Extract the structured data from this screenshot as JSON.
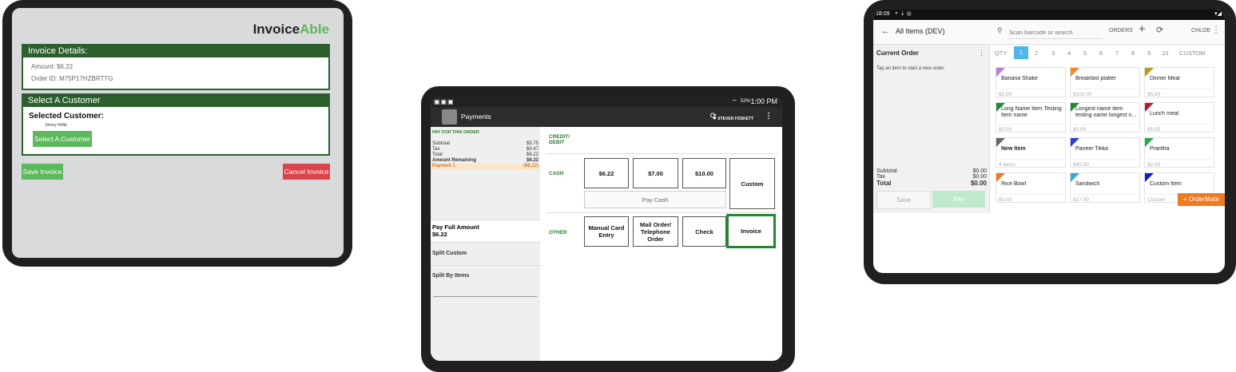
{
  "invoiceable": {
    "logo_main": "Invoice",
    "logo_accent": "Able",
    "invoice_details_header": "Invoice Details:",
    "amount": "Amount: $6.22",
    "order_id": "Order ID: M75P17HZBRTTG",
    "select_customer_header": "Select A Customer",
    "selected_customer_label": "Selected Customer:",
    "customer_name": "Jimmy Hoffa",
    "select_customer_button": "Select A Customer",
    "save_button": "Save Invoice",
    "cancel_button": "Cancel Invoice",
    "colors": {
      "header_green": "#2c5f2d",
      "button_green": "#5cb85c",
      "button_red": "#d9434a"
    }
  },
  "payments": {
    "status_time": "1:00 PM",
    "battery": "52%",
    "title": "Payments",
    "user": "STEVEN FOSKETT",
    "pay_for_order": "PAY FOR THIS ORDER",
    "summary": [
      {
        "label": "Subtotal",
        "value": "$5.75"
      },
      {
        "label": "Tax",
        "value": "$0.47"
      },
      {
        "label": "Total",
        "value": "$6.22"
      },
      {
        "label": "Amount Remaining",
        "value": "$6.22"
      }
    ],
    "payment_row": {
      "label": "Payment 1",
      "value": "($6.22)"
    },
    "pay_full_label": "Pay Full Amount",
    "pay_full_value": "$6.22",
    "split_custom": "Split Custom",
    "split_items": "Split By Items",
    "credit_label": "CREDIT/",
    "debit_label": "DEBIT",
    "cash_label": "CASH",
    "other_label": "OTHER",
    "cash_options": [
      "$6.22",
      "$7.00",
      "$10.00"
    ],
    "custom_button": "Custom",
    "pay_cash_button": "Pay Cash",
    "other_options": [
      "Manual Card Entry",
      "Mail Order/ Telephone Order",
      "Check",
      "Invoice"
    ],
    "colors": {
      "accent_green": "#2c7a2e",
      "highlight": "#fde6c8"
    }
  },
  "pos": {
    "status_time": "18:09",
    "title": "All Items (DEV)",
    "search_placeholder": "Scan barcode or search",
    "orders_label": "ORDERS",
    "user": "CHLOE",
    "current_order": "Current Order",
    "empty_hint": "Tap an item to start a new order.",
    "qty_label": "QTY",
    "qty_options": [
      "1",
      "2",
      "3",
      "4",
      "5",
      "6",
      "7",
      "8",
      "9",
      "10",
      "CUSTOM"
    ],
    "subtotal_label": "Subtotal",
    "subtotal_value": "$0.00",
    "tax_label": "Tax",
    "tax_value": "$0.00",
    "total_label": "Total",
    "total_value": "$0.00",
    "save_button": "Save",
    "pay_button": "Pay",
    "items": [
      {
        "name": "Banana Shake",
        "price": "$2.00",
        "color": "#b27ee0"
      },
      {
        "name": "Breakfast platter",
        "price": "$100.00",
        "color": "#f08a2c"
      },
      {
        "name": "Dinner Meal",
        "price": "$5.50",
        "color": "#b99a16"
      },
      {
        "name": "Long Name Item Testing Item name",
        "price": "$0.00",
        "color": "#1e8a3a"
      },
      {
        "name": "Longest name item testing name longest n...",
        "price": "$0.00",
        "color": "#1e8a3a"
      },
      {
        "name": "Lunch meal",
        "price": "$5.05",
        "color": "#b0202c"
      },
      {
        "name": "New Item",
        "price": "4 items",
        "color": "#666666"
      },
      {
        "name": "Paneer Tikka",
        "price": "$40.00",
        "color": "#2a3fd1"
      },
      {
        "name": "Prantha",
        "price": "$2.00",
        "color": "#2aa84a"
      },
      {
        "name": "Rice Bowl",
        "price": "$3.00",
        "color": "#f07a20"
      },
      {
        "name": "Sandwich",
        "price": "$17.00",
        "color": "#33a6e0"
      },
      {
        "name": "Custom Item",
        "price": "Custom",
        "color": "#1a1ad1"
      }
    ],
    "ordermate_button": "OrderMate",
    "colors": {
      "qty_selected": "#4fb6e8",
      "pay_green": "#bfe8cc",
      "ordermate": "#f07a20"
    }
  }
}
